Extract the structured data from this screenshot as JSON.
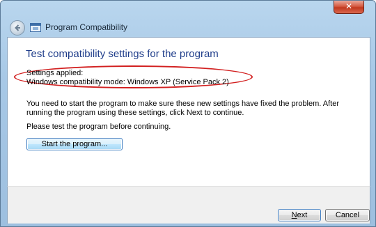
{
  "window": {
    "title": "Program Compatibility",
    "close_glyph": "✕",
    "back_icon": "back-arrow-icon"
  },
  "content": {
    "heading": "Test compatibility settings for the program",
    "settings_label": "Settings applied:",
    "settings_value": "Windows compatibility mode: Windows XP (Service Pack 2)",
    "instruction_line1": "You need to start the program to make sure these new settings have fixed the problem. After",
    "instruction_line2": "running the program using these settings, click Next to continue.",
    "test_prompt": "Please test the program before continuing.",
    "start_button": "Start the program..."
  },
  "footer": {
    "next_mnemonic": "N",
    "next_rest": "ext",
    "cancel_label": "Cancel"
  },
  "colors": {
    "heading": "#1f3d8a",
    "annotation_ellipse": "#d21f1f",
    "title_bar": "#a7c8e6",
    "close_button": "#c2381f"
  }
}
